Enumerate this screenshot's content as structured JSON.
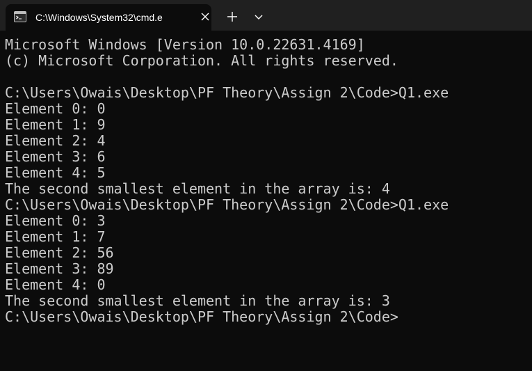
{
  "tab": {
    "title": "C:\\Windows\\System32\\cmd.e",
    "icon": "cmd-icon",
    "close_icon": "close-icon"
  },
  "titlebar": {
    "new_tab_icon": "plus-icon",
    "dropdown_icon": "chevron-down-icon"
  },
  "colors": {
    "terminal_bg": "#0c0c0c",
    "titlebar_bg": "#202020",
    "text": "#cccccc"
  },
  "terminal": {
    "lines": [
      "Microsoft Windows [Version 10.0.22631.4169]",
      "(c) Microsoft Corporation. All rights reserved.",
      "",
      "C:\\Users\\Owais\\Desktop\\PF Theory\\Assign 2\\Code>Q1.exe",
      "Element 0: 0",
      "Element 1: 9",
      "Element 2: 4",
      "Element 3: 6",
      "Element 4: 5",
      "The second smallest element in the array is: 4",
      "C:\\Users\\Owais\\Desktop\\PF Theory\\Assign 2\\Code>Q1.exe",
      "Element 0: 3",
      "Element 1: 7",
      "Element 2: 56",
      "Element 3: 89",
      "Element 4: 0",
      "The second smallest element in the array is: 3",
      "C:\\Users\\Owais\\Desktop\\PF Theory\\Assign 2\\Code>"
    ]
  }
}
